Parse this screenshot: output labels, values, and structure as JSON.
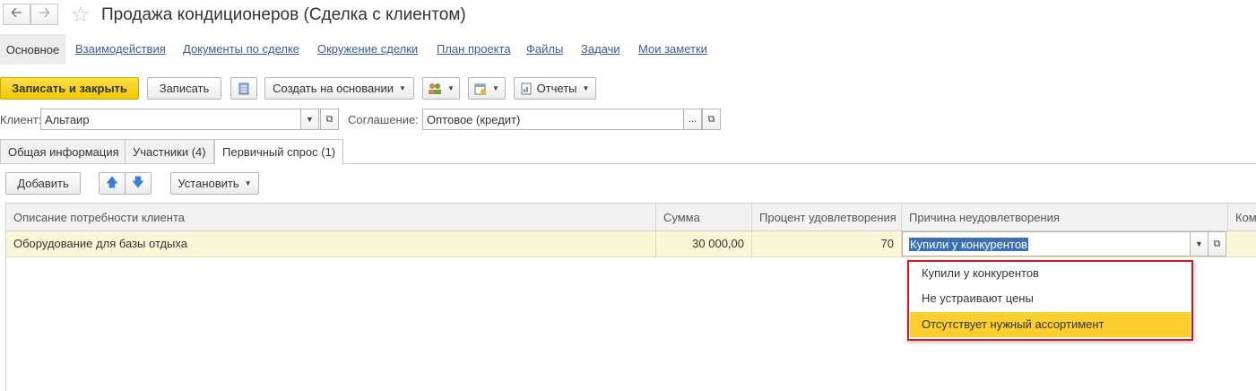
{
  "window": {
    "title": "Продажа кондиционеров (Сделка с клиентом)"
  },
  "nav": {
    "back_icon": "arrow-left-icon",
    "forward_icon": "arrow-right-icon",
    "favorite_icon": "star-icon"
  },
  "section_tabs": [
    {
      "label": "Основное"
    },
    {
      "label": "Взаимодействия"
    },
    {
      "label": "Документы по сделке"
    },
    {
      "label": "Окружение сделки"
    },
    {
      "label": "План проекта"
    },
    {
      "label": "Файлы"
    },
    {
      "label": "Задачи"
    },
    {
      "label": "Мои заметки"
    }
  ],
  "toolbar": {
    "save_close_label": "Записать и закрыть",
    "save_label": "Записать",
    "create_based_label": "Создать на основании",
    "reports_label": "Отчеты",
    "accent_color": "#f5d312"
  },
  "header_fields": {
    "client_label": "Клиент:",
    "client_value": "Альтаир",
    "agreement_label": "Соглашение:",
    "agreement_value": "Оптовое (кредит)"
  },
  "page_tabs": [
    {
      "label": "Общая информация"
    },
    {
      "label": "Участники (4)"
    },
    {
      "label": "Первичный спрос (1)"
    }
  ],
  "table_toolbar": {
    "add_label": "Добавить",
    "set_label": "Установить"
  },
  "table": {
    "columns": [
      "Описание потребности клиента",
      "Сумма",
      "Процент удовлетворения",
      "Причина неудовлетворения",
      "Ком"
    ],
    "rows": [
      {
        "description": "Оборудование для базы отдыха",
        "sum": "30 000,00",
        "percent": "70",
        "reason": "Купили у конкурентов"
      }
    ]
  },
  "dropdown": {
    "options": [
      "Купили у конкурентов",
      "Не устраивают цены",
      "Отсутствует нужный ассортимент"
    ],
    "highlighted_index": 2,
    "highlight_color": "#fbcf2e",
    "frame_color": "#d9141e"
  }
}
